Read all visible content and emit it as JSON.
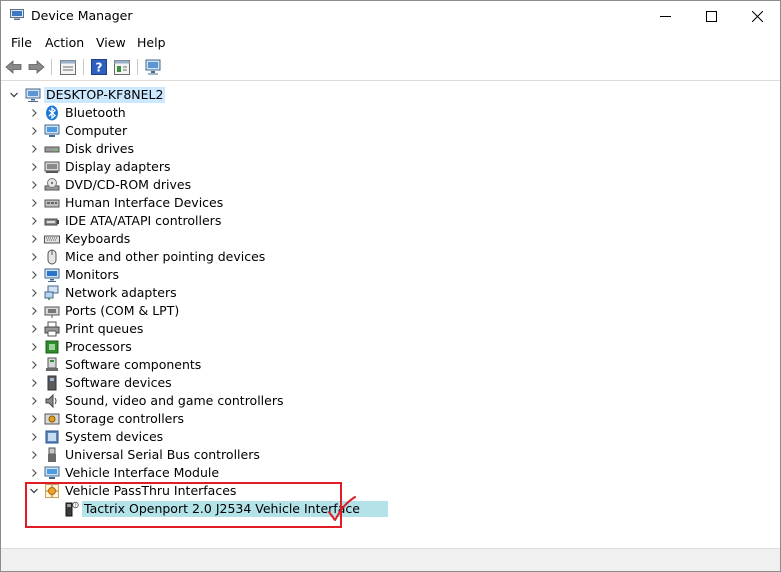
{
  "window": {
    "title": "Device Manager",
    "minimize_glyph": "—",
    "maximize_glyph": "☐",
    "close_glyph": "✕"
  },
  "menu": [
    "File",
    "Action",
    "View",
    "Help"
  ],
  "toolbar": {
    "icons": [
      "back-arrow-icon",
      "forward-arrow-icon",
      "properties-icon",
      "help-icon",
      "update-driver-icon",
      "scan-hardware-icon"
    ]
  },
  "tree": {
    "root": "DESKTOP-KF8NEL2",
    "categories": [
      {
        "label": "Bluetooth",
        "icon": "bluetooth-icon"
      },
      {
        "label": "Computer",
        "icon": "computer-icon"
      },
      {
        "label": "Disk drives",
        "icon": "disk-drive-icon"
      },
      {
        "label": "Display adapters",
        "icon": "display-adapter-icon"
      },
      {
        "label": "DVD/CD-ROM drives",
        "icon": "dvd-drive-icon"
      },
      {
        "label": "Human Interface Devices",
        "icon": "hid-icon"
      },
      {
        "label": "IDE ATA/ATAPI controllers",
        "icon": "ide-controller-icon"
      },
      {
        "label": "Keyboards",
        "icon": "keyboard-icon"
      },
      {
        "label": "Mice and other pointing devices",
        "icon": "mouse-icon"
      },
      {
        "label": "Monitors",
        "icon": "monitor-icon"
      },
      {
        "label": "Network adapters",
        "icon": "network-adapter-icon"
      },
      {
        "label": "Ports (COM & LPT)",
        "icon": "port-icon"
      },
      {
        "label": "Print queues",
        "icon": "printer-icon"
      },
      {
        "label": "Processors",
        "icon": "processor-icon"
      },
      {
        "label": "Software components",
        "icon": "software-component-icon"
      },
      {
        "label": "Software devices",
        "icon": "software-device-icon"
      },
      {
        "label": "Sound, video and game controllers",
        "icon": "speaker-icon"
      },
      {
        "label": "Storage controllers",
        "icon": "storage-controller-icon"
      },
      {
        "label": "System devices",
        "icon": "system-device-icon"
      },
      {
        "label": "Universal Serial Bus controllers",
        "icon": "usb-icon"
      },
      {
        "label": "Vehicle Interface Module",
        "icon": "vehicle-module-icon"
      },
      {
        "label": "Vehicle PassThru Interfaces",
        "icon": "vehicle-passthru-icon"
      }
    ],
    "expanded_child": {
      "label": "Tactrix Openport 2.0 J2534 Vehicle Interface",
      "icon": "obd-device-icon"
    }
  },
  "colors": {
    "annotation": "#e01c24",
    "selection": "#b3e2e9",
    "root_selection": "#cce8ff"
  }
}
